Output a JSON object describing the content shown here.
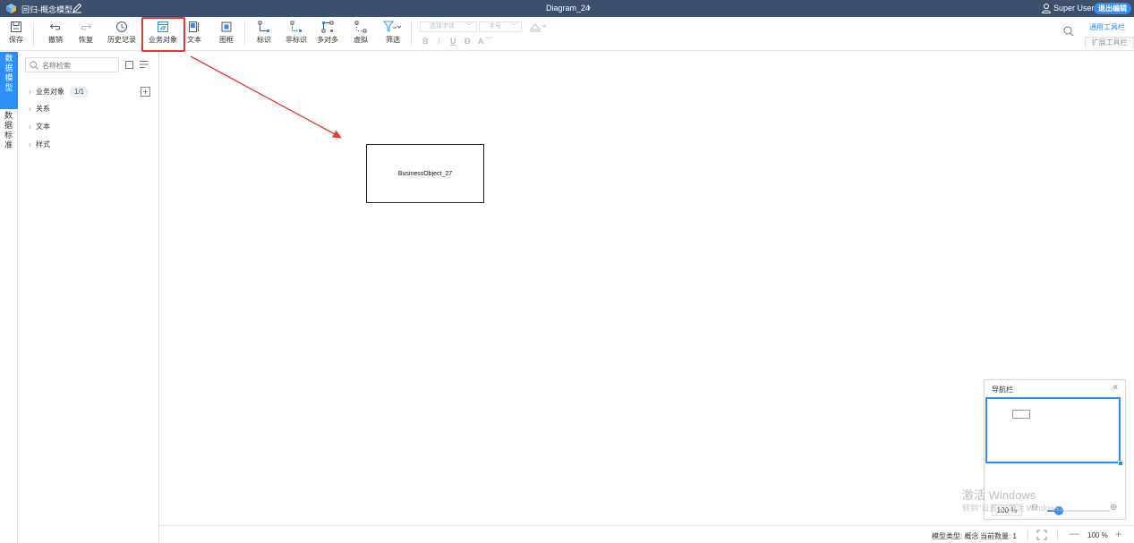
{
  "titlebar": {
    "model_title": "回归-概念模型",
    "diagram_title": "Diagram_24",
    "user_name": "Super User",
    "exit_label": "退出编辑"
  },
  "toolbar": {
    "save": "保存",
    "undo": "撤销",
    "redo": "恢复",
    "history": "历史记录",
    "business_object": "业务对象",
    "text": "文本",
    "frame": "图框",
    "identifying": "标识",
    "non_identifying": "非标识",
    "many_to_many": "多对多",
    "virtual": "虚拟",
    "filter": "筛选",
    "font_select": "选择字体",
    "size_select": "字号",
    "format_bold": "B",
    "format_italic": "I",
    "format_underline": "U",
    "format_strike": "Đ",
    "format_fontcolor": "A",
    "common_tools": "通用工具栏",
    "extended_tools": "扩展工具栏"
  },
  "left_tabs": {
    "data_model": "数据模型",
    "data_standard": "数据标准"
  },
  "sidebar": {
    "search_placeholder": "名称检索",
    "tree": [
      {
        "label": "业务对象",
        "count": "1/1"
      },
      {
        "label": "关系"
      },
      {
        "label": "文本"
      },
      {
        "label": "样式"
      }
    ]
  },
  "canvas": {
    "entity_label": "BusinessObject_27"
  },
  "navigator": {
    "title": "导航栏",
    "zoom": "100 %"
  },
  "watermark": {
    "line1": "激活 Windows",
    "line2": "转到\"设置\"以激活 Windows。"
  },
  "statusbar": {
    "model_type": "模型类型: 概念",
    "current_count": "当前数量: 1",
    "zoom_value": "100",
    "zoom_unit": "%"
  },
  "colors": {
    "titlebar_bg": "#3d4f6b",
    "accent": "#2f8ef5",
    "highlight_box": "#e53935"
  }
}
